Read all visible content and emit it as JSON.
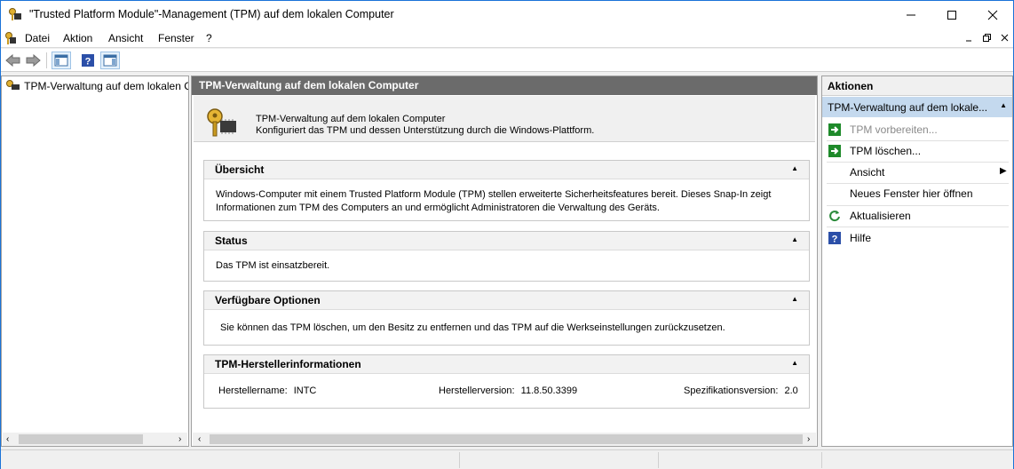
{
  "window": {
    "title": "\"Trusted Platform Module\"-Management (TPM) auf dem lokalen Computer"
  },
  "menu": {
    "items": [
      "Datei",
      "Aktion",
      "Ansicht",
      "Fenster",
      "?"
    ]
  },
  "tree": {
    "item": "TPM-Verwaltung auf dem lokalen C"
  },
  "center": {
    "header": "TPM-Verwaltung auf dem lokalen Computer",
    "intro_title": "TPM-Verwaltung auf dem lokalen Computer",
    "intro_desc": "Konfiguriert das TPM und dessen Unterstützung durch die Windows-Plattform.",
    "sections": {
      "overview": {
        "title": "Übersicht",
        "line1": "Windows-Computer mit einem Trusted Platform Module (TPM) stellen erweiterte Sicherheitsfeatures bereit. Dieses Snap-In zeigt",
        "line2": "Informationen zum TPM des Computers an und ermöglicht Administratoren die Verwaltung des Geräts."
      },
      "status": {
        "title": "Status",
        "text": "Das TPM ist einsatzbereit."
      },
      "options": {
        "title": "Verfügbare Optionen",
        "text": "Sie können das TPM löschen, um den Besitz zu entfernen und das TPM auf die Werkseinstellungen zurückzusetzen."
      },
      "manufacturer": {
        "title": "TPM-Herstellerinformationen",
        "name_label": "Herstellername:",
        "name_value": "INTC",
        "version_label": "Herstellerversion:",
        "version_value": "11.8.50.3399",
        "spec_label": "Spezifikationsversion:",
        "spec_value": "2.0"
      }
    }
  },
  "actions": {
    "header": "Aktionen",
    "subheader": "TPM-Verwaltung auf dem lokale...",
    "items": {
      "prepare": "TPM vorbereiten...",
      "clear": "TPM löschen...",
      "view": "Ansicht",
      "new_window": "Neues Fenster hier öffnen",
      "refresh": "Aktualisieren",
      "help": "Hilfe"
    }
  },
  "colors": {
    "accent": "#1a73d8",
    "header_gray": "#6b6b6b",
    "selection": "#c4d9ee",
    "disabled_text": "#8a8a8a"
  }
}
